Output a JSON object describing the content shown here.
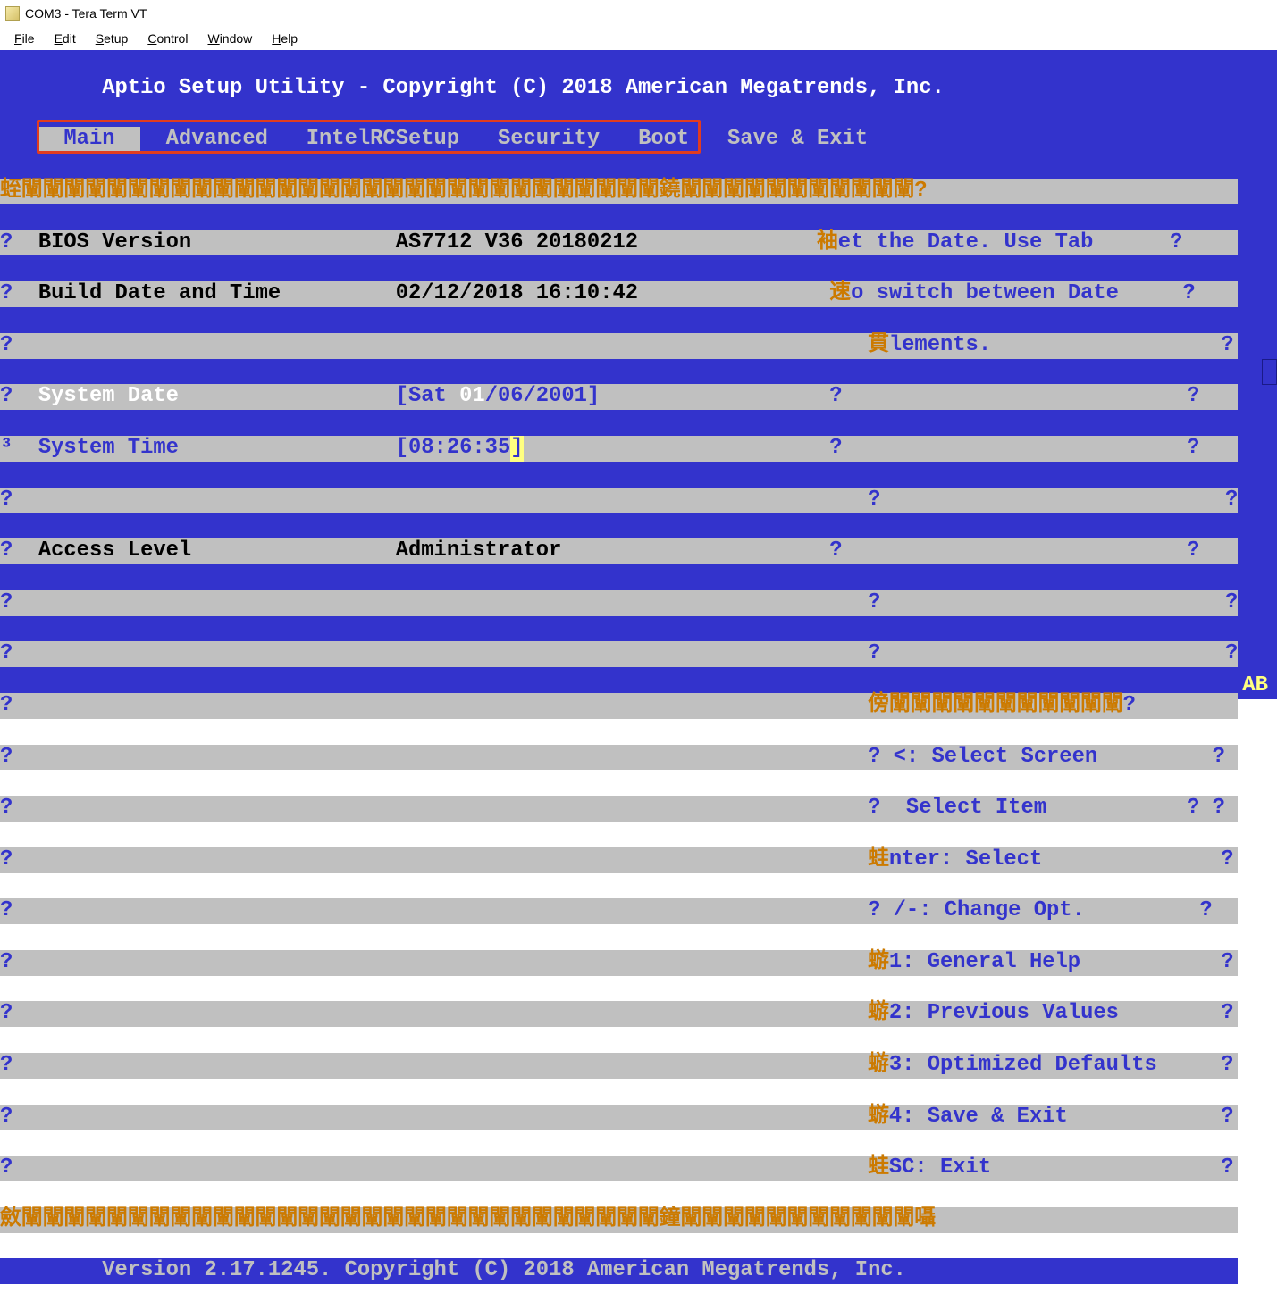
{
  "window": {
    "title": "COM3 - Tera Term VT"
  },
  "menu": {
    "file": "File",
    "edit": "Edit",
    "setup": "Setup",
    "control": "Control",
    "window": "Window",
    "help": "Help"
  },
  "bios": {
    "header": "Aptio Setup Utility - Copyright (C) 2018 American Megatrends, Inc.",
    "tabs": {
      "main": "Main",
      "advanced": "Advanced",
      "intelrc": "IntelRCSetup",
      "security": "Security",
      "boot": "Boot",
      "save_exit": "Save & Exit"
    },
    "fields": {
      "bios_version_label": "BIOS Version",
      "bios_version_value": "AS7712 V36 20180212",
      "build_date_label": "Build Date and Time",
      "build_date_value": "02/12/2018 16:10:42",
      "system_date_label": "System Date",
      "system_date_prefix": "[Sat ",
      "system_date_day": "01",
      "system_date_rest": "/06/2001]",
      "system_time_label": "System Time",
      "system_time_prefix": "[08:26:35",
      "system_time_cursor": "]",
      "access_level_label": "Access Level",
      "access_level_value": "Administrator"
    },
    "help": {
      "line1a": "袖",
      "line1b": "et the Date. Use Tab",
      "line2a": "速",
      "line2b": "o switch between Date",
      "line3a": "貫",
      "line3b": "lements.",
      "nav1": " <: Select Screen",
      "nav2": "  Select Item",
      "nav3a": "蛙",
      "nav3b": "nter: Select",
      "nav4": " /-: Change Opt.",
      "nav5a": "蝣",
      "nav5b": "1: General Help",
      "nav6a": "蝣",
      "nav6b": "2: Previous Values",
      "nav7a": "蝣",
      "nav7b": "3: Optimized Defaults",
      "nav8a": "蝣",
      "nav8b": "4: Save & Exit",
      "nav9a": "蛙",
      "nav9b": "SC: Exit"
    },
    "footer": "Version 2.17.1245. Copyright (C) 2018 American Megatrends, Inc.",
    "ab": "AB",
    "garble_top_left": "蛭",
    "garble_top_chars": "闡闡闡闡闡闡闡闡闡闡闡闡闡闡闡闡闡闡闡闡闡闡闡闡闡闡闡闡闡闡鐃闡闡闡闡闡闡闡闡闡闡闡",
    "garble_mid_left": "傍",
    "garble_mid_chars": "闡闡闡闡闡闡闡闡闡闡闡",
    "garble_bot_left": "斂",
    "garble_bot_chars": "闡闡闡闡闡闡闡闡闡闡闡闡闡闡闡闡闡闡闡闡闡闡闡闡闡闡闡闡闡闡鐘闡闡闡闡闡闡闡闡闡闡闡",
    "garble_bot_end": "囁",
    "q": "?",
    "three": "³"
  }
}
